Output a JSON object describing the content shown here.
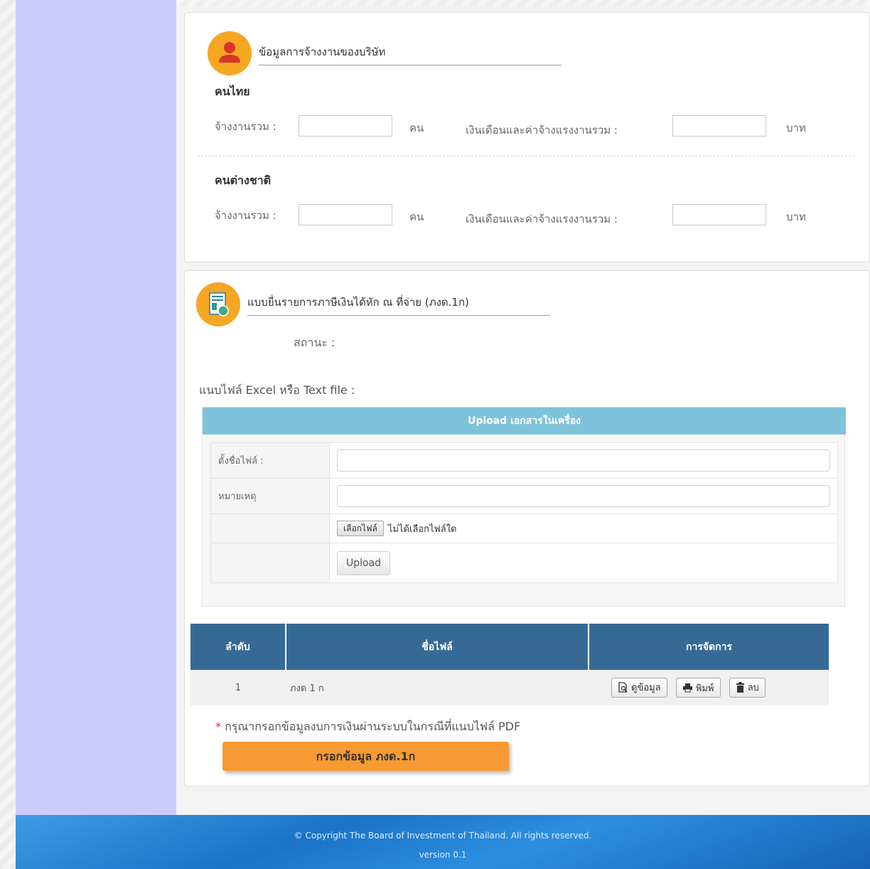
{
  "employment": {
    "title": "ข้อมูลการจ้างงานของบริษัท",
    "thai": {
      "label": "คนไทย",
      "employees_label": "จ้างงานรวม :",
      "employees_unit": "คน",
      "salary_label": "เงินเดือนและค่าจ้างแรงงานรวม :",
      "salary_unit": "บาท"
    },
    "foreign": {
      "label": "คนต่างชาติ",
      "employees_label": "จ้างงานรวม :",
      "employees_unit": "คน",
      "salary_label": "เงินเดือนและค่าจ้างแรงงานรวม :",
      "salary_unit": "บาท"
    }
  },
  "tax_form": {
    "title": "แบบยื่นรายการภาษีเงินได้หัก ณ ที่จ่าย (ภงด.1ก)",
    "status_label": "สถานะ :",
    "attach_label": "แนบไฟล์ Excel หรือ Text file :"
  },
  "upload": {
    "header": "Upload เอกสารในเครื่อง",
    "filename_label": "ตั้งชื่อไฟล์ :",
    "remark_label": "หมายเหตุ",
    "choose_file_label": "เลือกไฟล์",
    "no_file_text": "ไม่ได้เลือกไฟล์ใด",
    "upload_button": "Upload"
  },
  "file_table": {
    "headers": [
      "ลำดับ",
      "ชื่อไฟล์",
      "การจัดการ"
    ],
    "rows": [
      {
        "no": "1",
        "name": "ภงด 1 ก"
      }
    ],
    "actions": {
      "view": "ดูข้อมูล",
      "print": "พิมพ์",
      "delete": "ลบ"
    }
  },
  "note": {
    "star": "*",
    "text": "กรุณากรอกข้อมูลงบการเงินผ่านระบบในกรณีที่แนบไฟล์ PDF"
  },
  "fill_button": "กรอกข้อมูล ภงด.1ก",
  "footer": {
    "copyright": "© Copyright The Board of Investment of Thailand. All rights reserved.",
    "version": "version 0.1"
  },
  "colors": {
    "sidebar": "#ccccfb",
    "icon_bg": "#f5a623",
    "upload_header": "#7ec2da",
    "table_header": "#366a95",
    "fill_button": "#f89a33"
  }
}
